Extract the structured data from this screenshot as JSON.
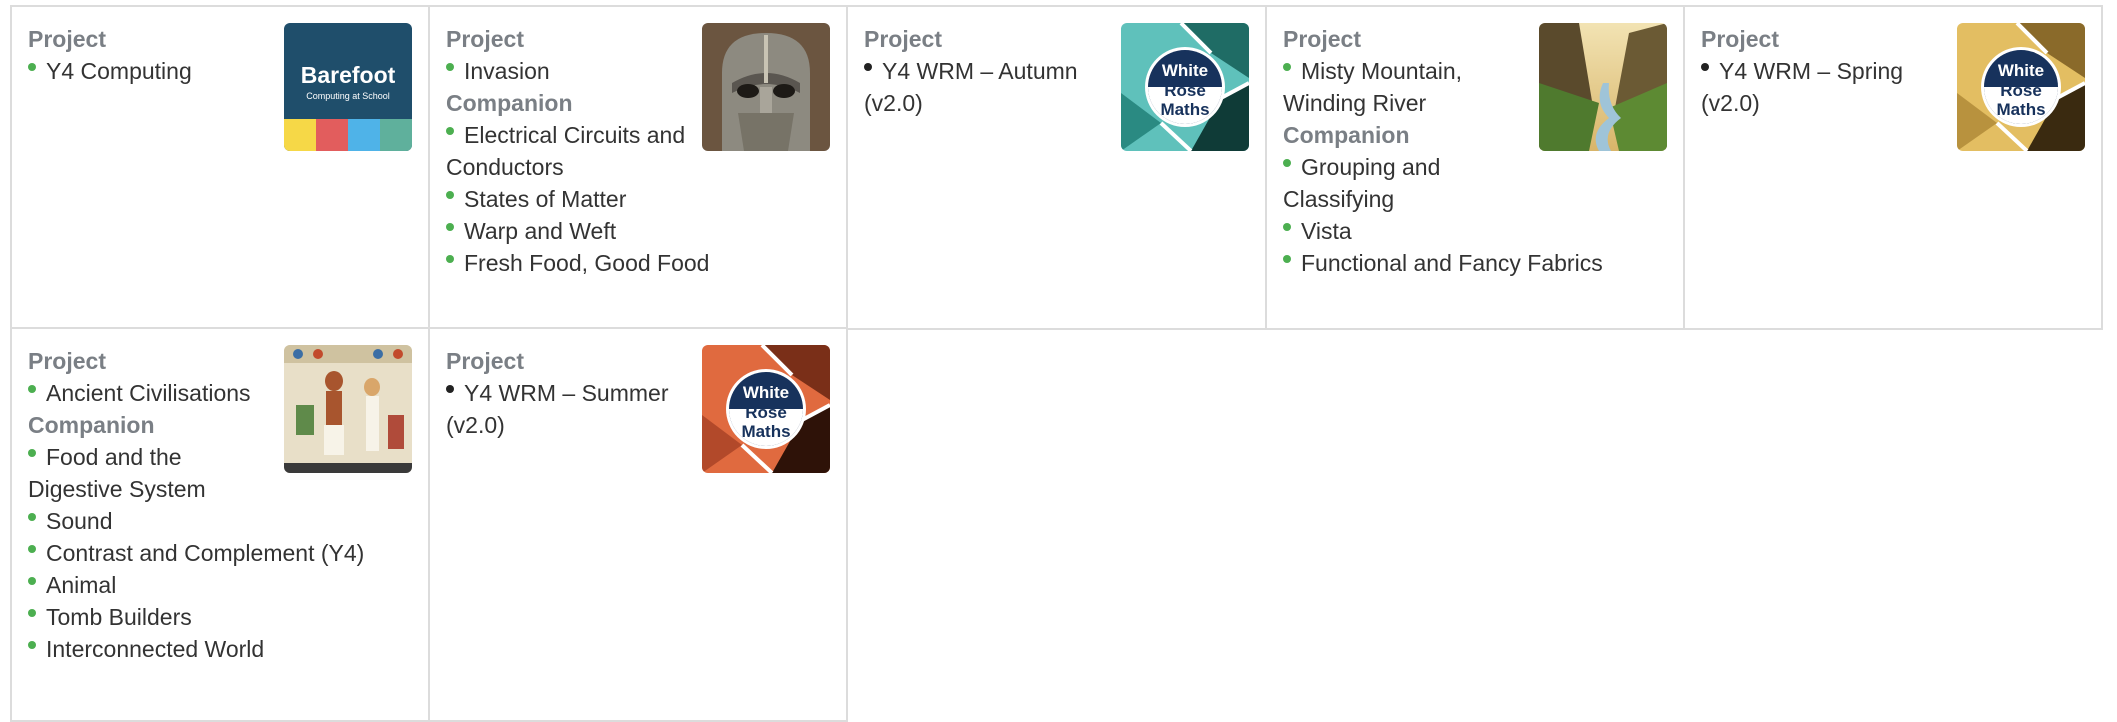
{
  "colors": {
    "bullet_green": "#4caf50",
    "bullet_black": "#222222",
    "heading": "#7a7f85"
  },
  "cards": [
    {
      "thumb_icon": "barefoot-logo",
      "thumb_title": "Barefoot",
      "thumb_subtitle": "Computing at School",
      "sections": [
        {
          "heading": "Project",
          "items": [
            "Y4 Computing"
          ],
          "bullet": "green"
        }
      ]
    },
    {
      "thumb_icon": "anglo-saxon-helmet-image",
      "sections": [
        {
          "heading": "Project",
          "items": [
            "Invasion"
          ],
          "bullet": "green"
        },
        {
          "heading": "Companion",
          "items": [
            "Electrical Circuits and Conductors",
            "States of Matter",
            "Warp and Weft",
            "Fresh Food, Good Food"
          ],
          "bullet": "green"
        }
      ]
    },
    {
      "thumb_icon": "white-rose-maths-logo",
      "thumb_lines": [
        "White",
        "Rose",
        "Maths"
      ],
      "sections": [
        {
          "heading": "Project",
          "items": [
            "Y4 WRM – Autumn (v2.0)"
          ],
          "bullet": "black"
        }
      ]
    },
    {
      "thumb_icon": "mountain-river-image",
      "sections": [
        {
          "heading": "Project",
          "items": [
            "Misty Mountain, Winding River"
          ],
          "bullet": "green"
        },
        {
          "heading": "Companion",
          "items": [
            "Grouping and Classifying",
            "Vista",
            "Functional and Fancy Fabrics"
          ],
          "bullet": "green"
        }
      ]
    },
    {
      "thumb_icon": "white-rose-maths-logo",
      "thumb_lines": [
        "White",
        "Rose",
        "Maths"
      ],
      "sections": [
        {
          "heading": "Project",
          "items": [
            "Y4 WRM – Spring (v2.0)"
          ],
          "bullet": "black"
        }
      ]
    },
    {
      "thumb_icon": "egyptian-painting-image",
      "sections": [
        {
          "heading": "Project",
          "items": [
            "Ancient Civilisations"
          ],
          "bullet": "green"
        },
        {
          "heading": "Companion",
          "items": [
            "Food and the Digestive System",
            "Sound",
            "Contrast and Complement (Y4)",
            "Animal",
            "Tomb Builders",
            "Interconnected World"
          ],
          "bullet": "green"
        }
      ]
    },
    {
      "thumb_icon": "white-rose-maths-logo",
      "thumb_lines": [
        "White",
        "Rose",
        "Maths"
      ],
      "sections": [
        {
          "heading": "Project",
          "items": [
            "Y4 WRM – Summer (v2.0)"
          ],
          "bullet": "black"
        }
      ]
    }
  ]
}
